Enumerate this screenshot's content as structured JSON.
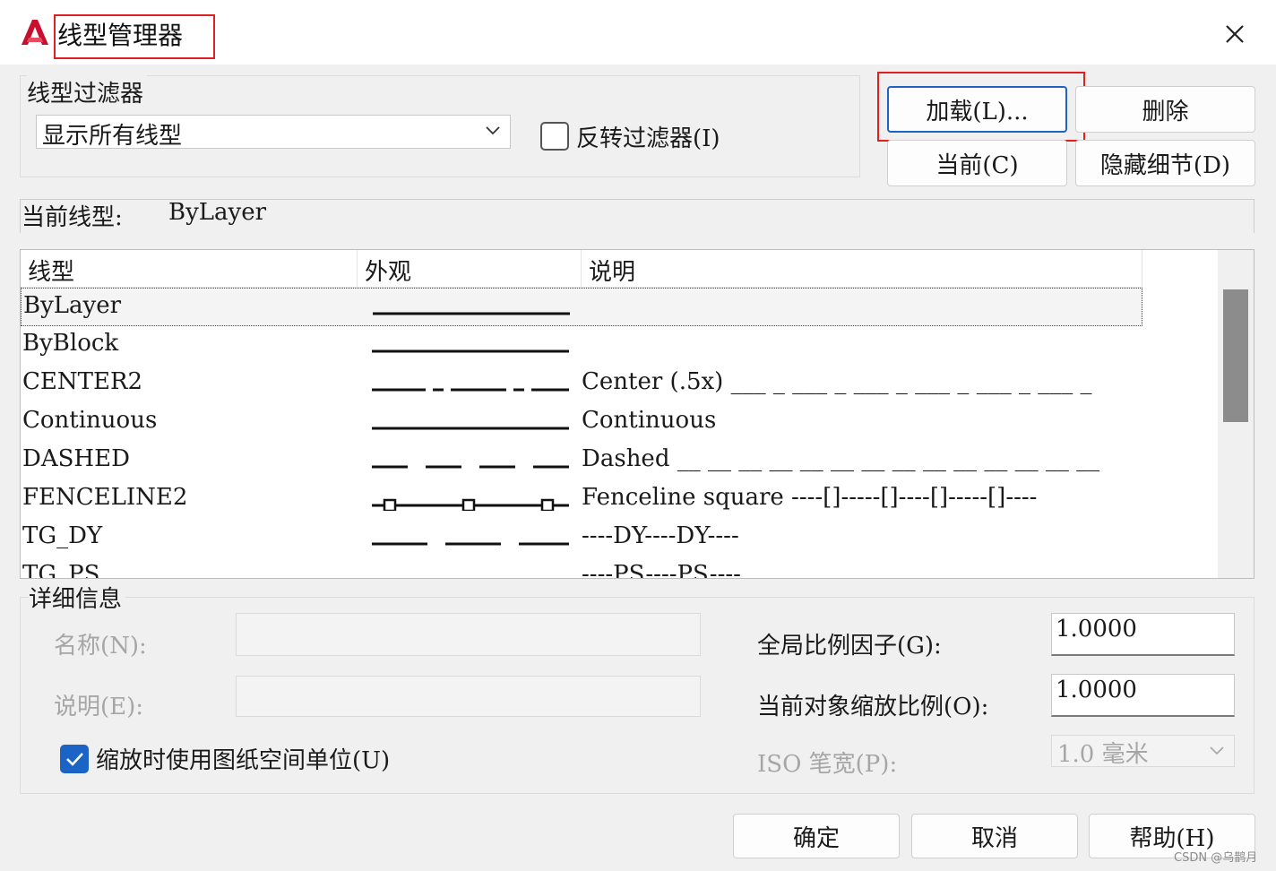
{
  "window": {
    "title": "线型管理器",
    "close_label": "×"
  },
  "filter": {
    "section_label": "线型过滤器",
    "selected": "显示所有线型",
    "invert_label": "反转过滤器(I)",
    "invert_checked": false
  },
  "buttons": {
    "load": "加载(L)...",
    "delete": "删除",
    "current": "当前(C)",
    "hide_details": "隐藏细节(D)",
    "ok": "确定",
    "cancel": "取消",
    "help": "帮助(H)"
  },
  "current_linetype": {
    "label": "当前线型:",
    "value": "ByLayer"
  },
  "table": {
    "headers": [
      "线型",
      "外观",
      "说明"
    ],
    "rows": [
      {
        "name": "ByLayer",
        "appearance": "solid-icon",
        "desc": "",
        "selected": true
      },
      {
        "name": "ByBlock",
        "appearance": "solid-icon",
        "desc": ""
      },
      {
        "name": "CENTER2",
        "appearance": "center-icon",
        "desc": "Center (.5x) ___ _ ___ _ ___ _ ___ _ ___ _ ___ _"
      },
      {
        "name": "Continuous",
        "appearance": "solid-icon",
        "desc": "Continuous"
      },
      {
        "name": "DASHED",
        "appearance": "dashed-icon",
        "desc": "Dashed __ __ __ __ __ __ __ __ __ __ __ __ __ __"
      },
      {
        "name": "FENCELINE2",
        "appearance": "fenceline-icon",
        "desc": "Fenceline square ----[]-----[]----[]-----[]----"
      },
      {
        "name": "TG_DY",
        "appearance": "long-dash-icon",
        "desc": "----DY----DY----"
      },
      {
        "name": "TG_PS",
        "appearance": "long-dash-icon",
        "desc": "----PS----PS----"
      }
    ]
  },
  "details": {
    "section_label": "详细信息",
    "name_label": "名称(N):",
    "name_value": "",
    "desc_label": "说明(E):",
    "desc_value": "",
    "paperspace_label": "缩放时使用图纸空间单位(U)",
    "paperspace_checked": true,
    "global_scale_label": "全局比例因子(G):",
    "global_scale_value": "1.0000",
    "object_scale_label": "当前对象缩放比例(O):",
    "object_scale_value": "1.0000",
    "iso_pen_label": "ISO 笔宽(P):",
    "iso_pen_value": "1.0 毫米"
  },
  "watermark": "CSDN @乌鹊月",
  "colors": {
    "accent": "#1b63c4",
    "highlight": "#e02020",
    "logo": "#c8102e"
  }
}
